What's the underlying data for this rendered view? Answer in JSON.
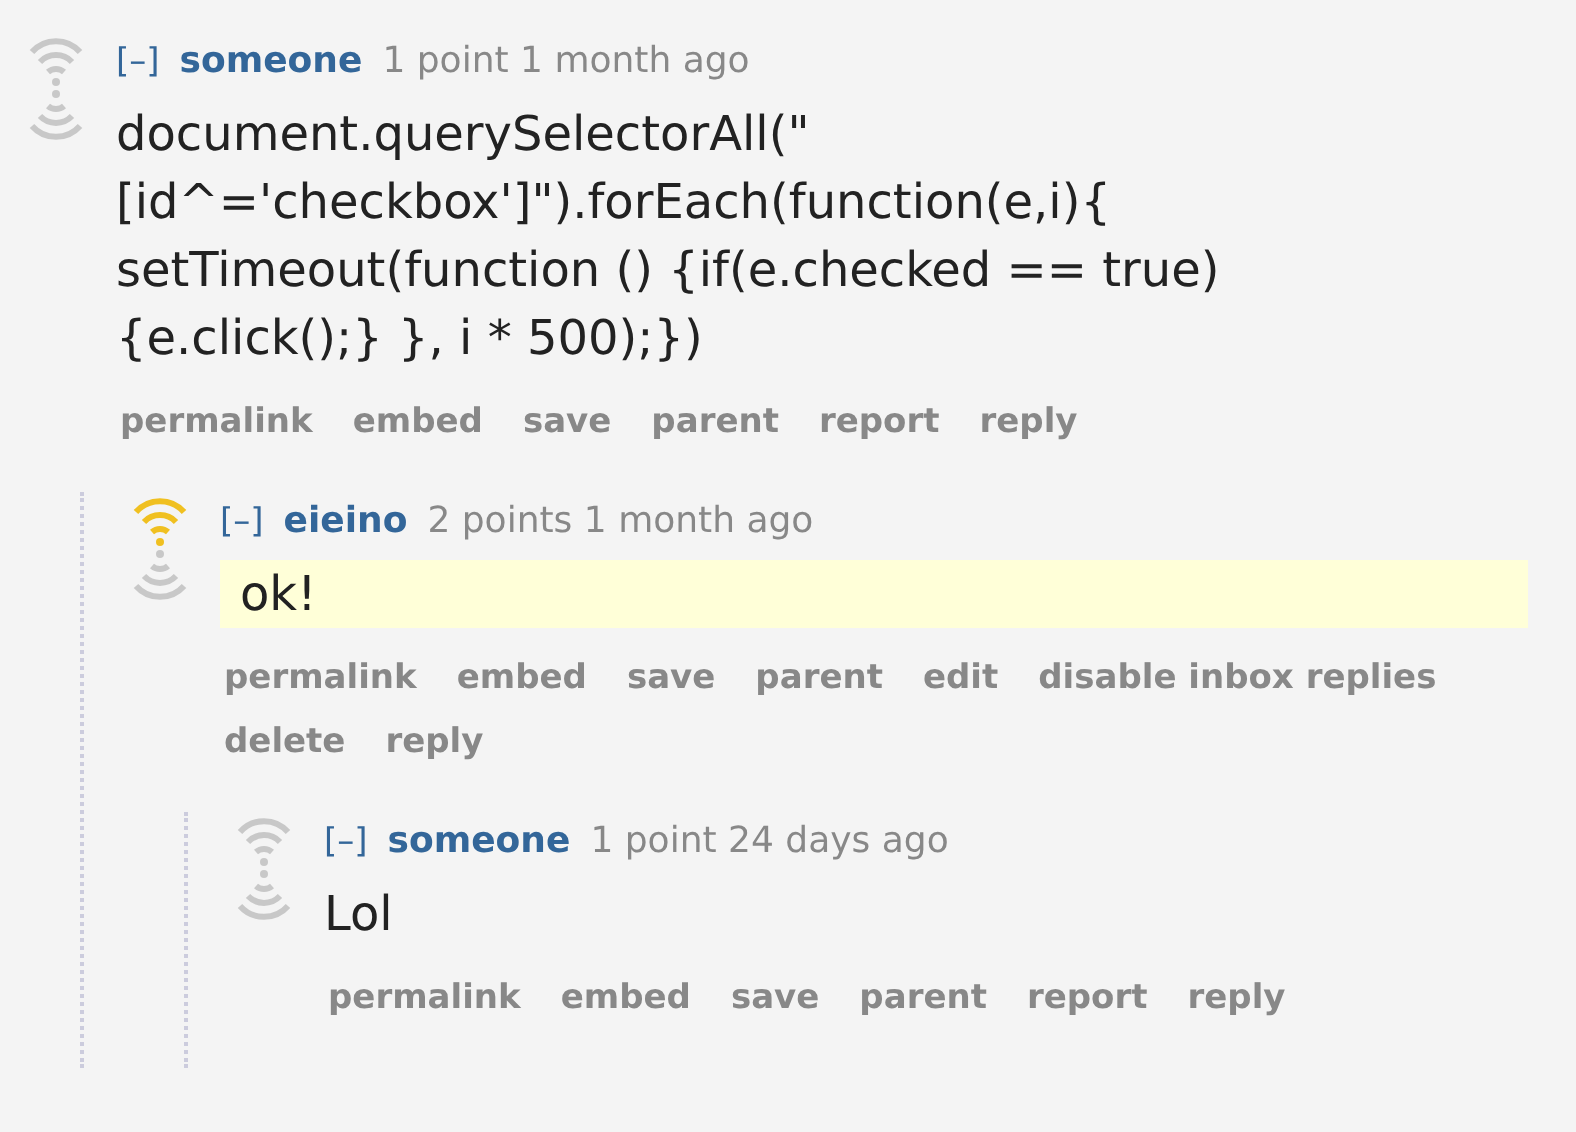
{
  "comments": [
    {
      "collapse": "[–]",
      "author": "someone",
      "score": "1 point",
      "time": "1 month ago",
      "upvoted": false,
      "highlighted": false,
      "body": "document.querySelectorAll(\"[id^='checkbox']\").forEach(function(e,i){ setTimeout(function () {if(e.checked == true) {e.click();} }, i * 500);})",
      "actions": [
        "permalink",
        "embed",
        "save",
        "parent",
        "report",
        "reply"
      ],
      "children": [
        {
          "collapse": "[–]",
          "author": "eieino",
          "score": "2 points",
          "time": "1 month ago",
          "upvoted": true,
          "highlighted": true,
          "body": "ok!",
          "actions": [
            "permalink",
            "embed",
            "save",
            "parent",
            "edit",
            "disable inbox replies",
            "delete",
            "reply"
          ],
          "children": [
            {
              "collapse": "[–]",
              "author": "someone",
              "score": "1 point",
              "time": "24 days ago",
              "upvoted": false,
              "highlighted": false,
              "body": "Lol",
              "actions": [
                "permalink",
                "embed",
                "save",
                "parent",
                "report",
                "reply"
              ]
            }
          ]
        }
      ]
    }
  ]
}
